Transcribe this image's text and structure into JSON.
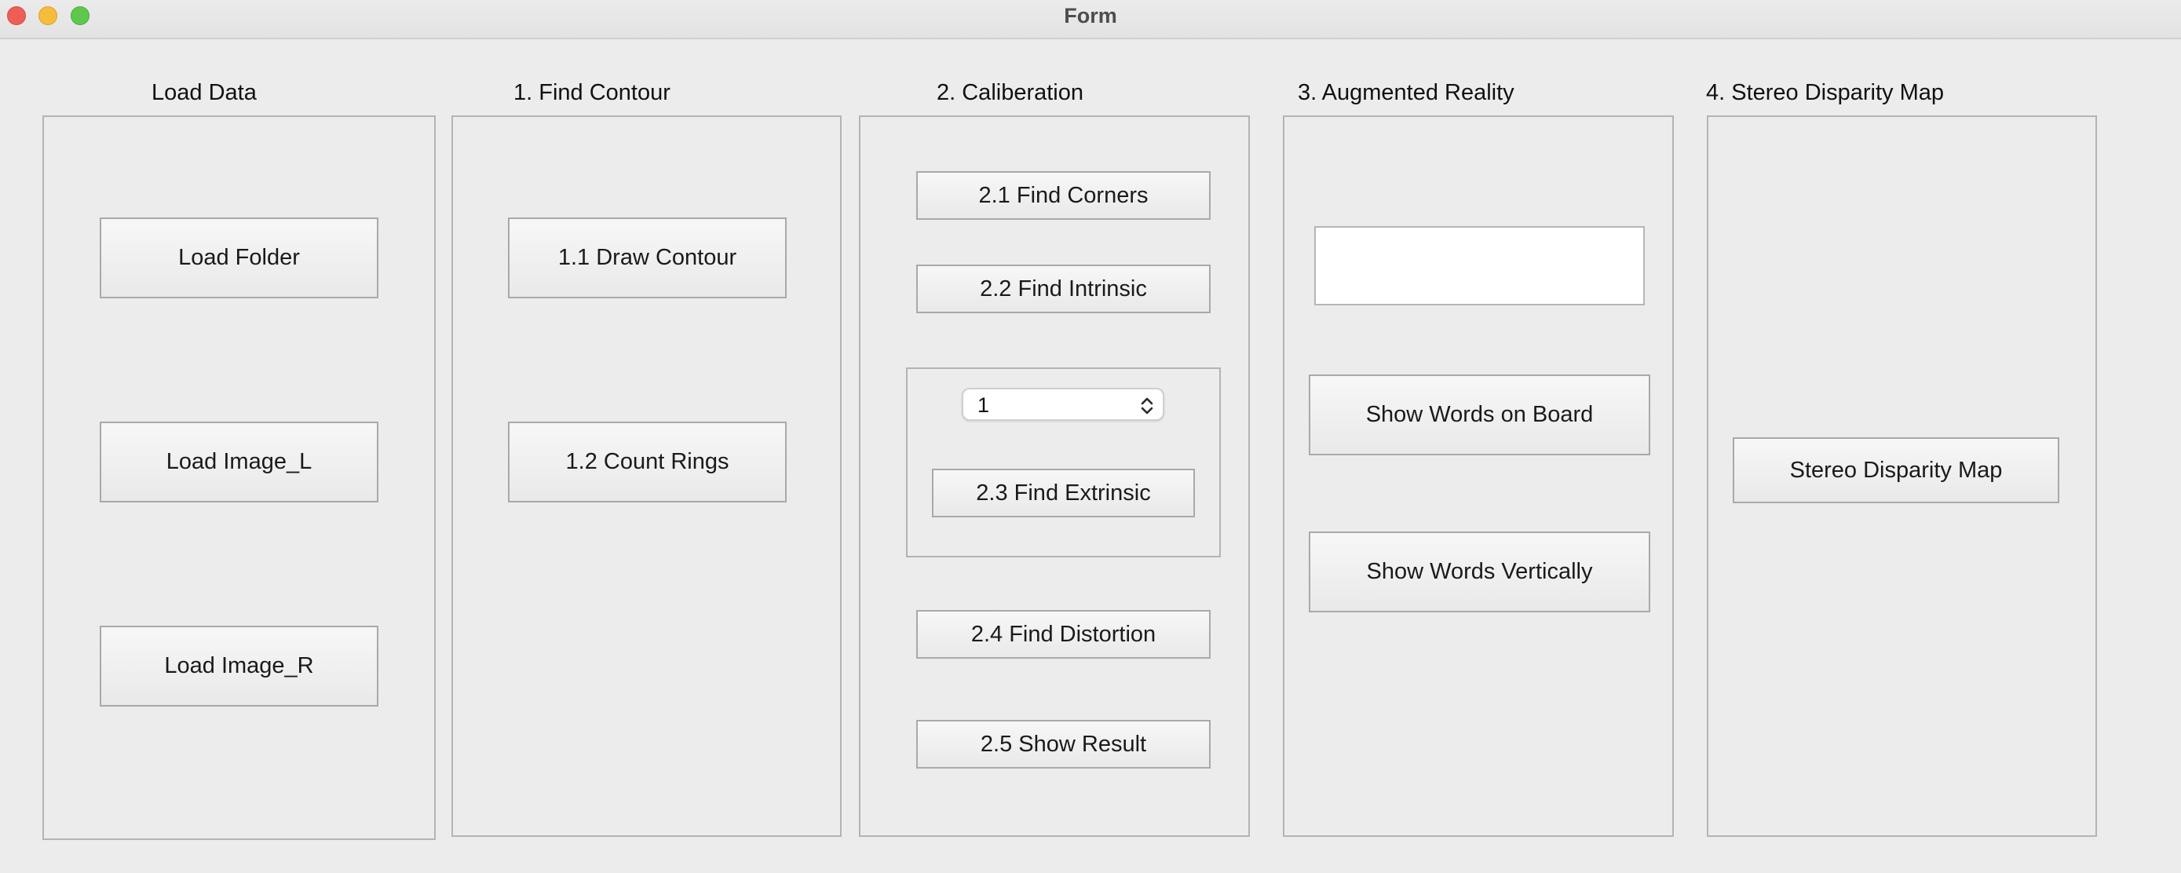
{
  "window": {
    "title": "Form"
  },
  "groups": {
    "load_data": {
      "label": "Load Data",
      "buttons": [
        "Load Folder",
        "Load Image_L",
        "Load Image_R"
      ]
    },
    "find_contour": {
      "label": "1. Find Contour",
      "buttons": [
        "1.1 Draw Contour",
        "1.2 Count Rings"
      ]
    },
    "calibration": {
      "label": "2. Caliberation",
      "find_corners": "2.1 Find Corners",
      "find_intrinsic": "2.2 Find Intrinsic",
      "extrinsic_index_value": "1",
      "find_extrinsic": "2.3 Find Extrinsic",
      "find_distortion": "2.4 Find Distortion",
      "show_result": "2.5 Show Result"
    },
    "augmented_reality": {
      "label": "3. Augmented Reality",
      "word_input_value": "",
      "show_words_on_board": "Show Words on Board",
      "show_words_vertically": "Show Words Vertically"
    },
    "stereo": {
      "label": "4. Stereo Disparity Map",
      "button": "Stereo Disparity Map"
    }
  },
  "icons": {
    "close": "close-window-icon",
    "minimize": "minimize-window-icon",
    "maximize": "maximize-window-icon",
    "spin_arrows": "up-down-chevron-icon"
  }
}
